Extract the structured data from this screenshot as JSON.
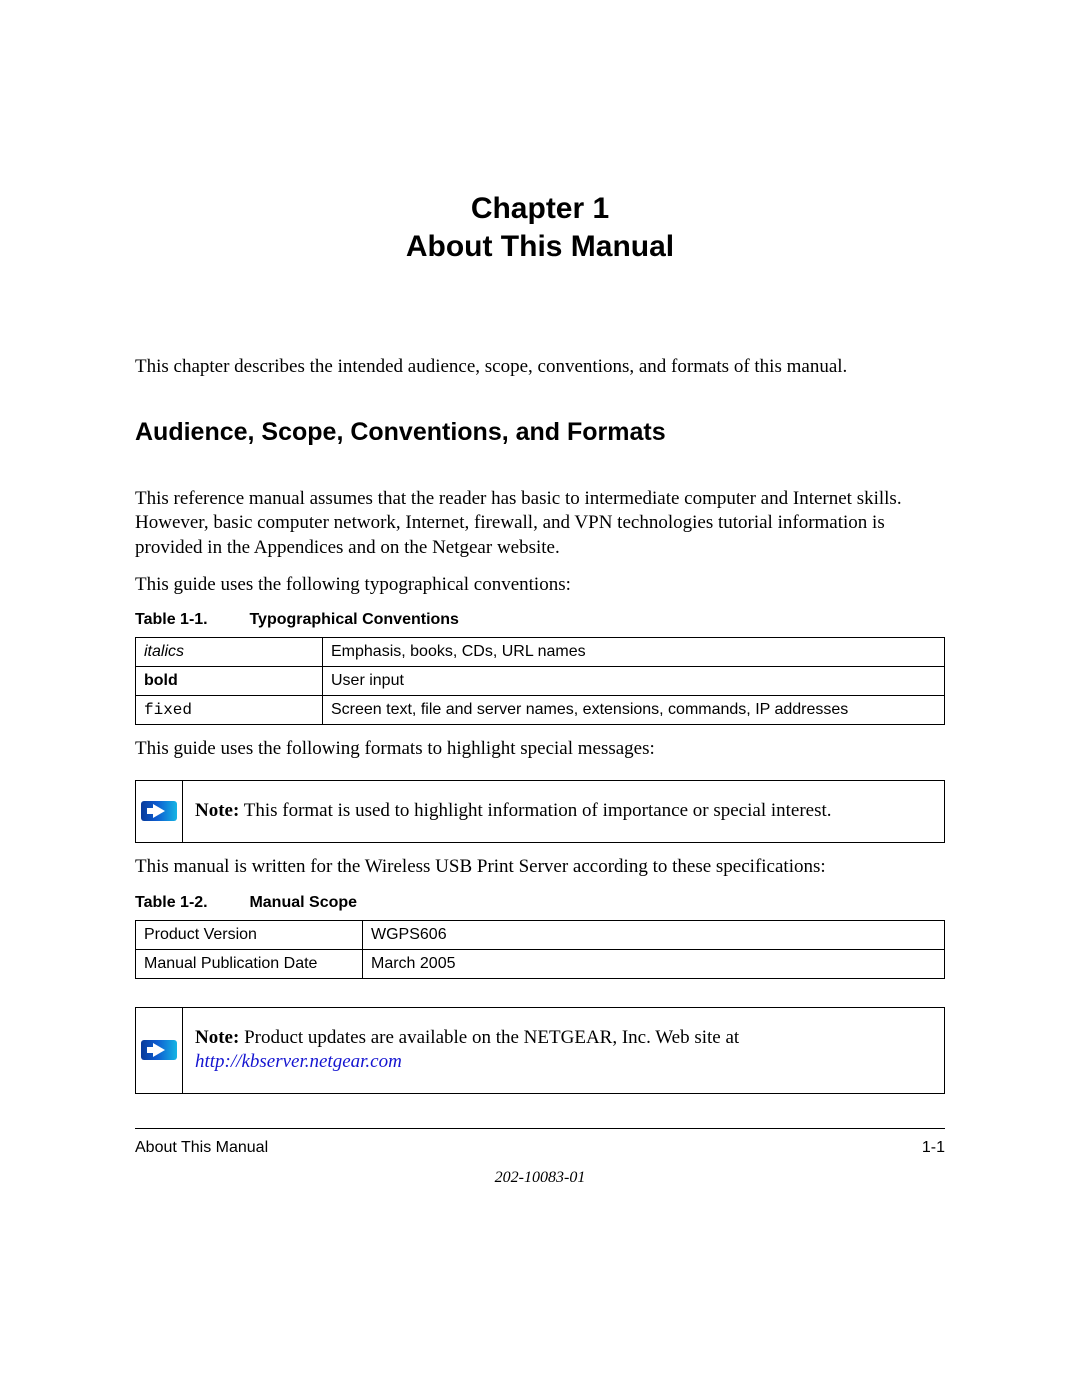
{
  "chapter": {
    "line1": "Chapter 1",
    "line2": "About This Manual"
  },
  "intro": "This chapter describes the intended audience, scope, conventions, and formats of this manual.",
  "section_heading": "Audience, Scope, Conventions, and Formats",
  "para1": "This reference manual assumes that the reader has basic to intermediate computer and Internet skills. However, basic computer network, Internet, firewall, and VPN technologies tutorial information is provided in the Appendices and on the Netgear website.",
  "para2": "This guide uses the following typographical conventions:",
  "table1": {
    "caption_label": "Table 1-1.",
    "caption_title": "Typographical Conventions",
    "rows": [
      {
        "term": "italics",
        "term_class": "italics",
        "desc": "Emphasis, books, CDs, URL names"
      },
      {
        "term": "bold",
        "term_class": "bold",
        "desc": "User input"
      },
      {
        "term": "fixed",
        "term_class": "fixed",
        "desc": "Screen text, file and server names, extensions, commands, IP addresses"
      }
    ]
  },
  "para3": "This guide uses the following formats to highlight special messages:",
  "note1": {
    "label": "Note:",
    "text": " This format is used to highlight information of importance or special interest."
  },
  "para4": "This manual is written for the Wireless USB Print Server according to these specifications:",
  "table2": {
    "caption_label": "Table 1-2.",
    "caption_title": "Manual Scope",
    "rows": [
      {
        "key": "Product Version",
        "val": "WGPS606"
      },
      {
        "key": "Manual Publication Date",
        "val": "March 2005"
      }
    ]
  },
  "note2": {
    "label": "Note:",
    "text": " Product updates are available on the NETGEAR, Inc. Web site at ",
    "link": "http://kbserver.netgear.com"
  },
  "footer": {
    "left": "About This Manual",
    "right": "1-1",
    "docnum": "202-10083-01"
  }
}
